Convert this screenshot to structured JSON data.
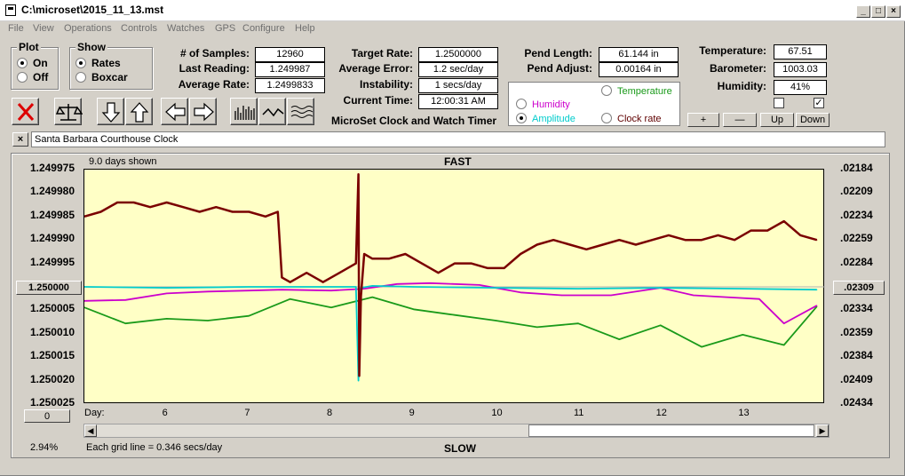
{
  "window": {
    "title": "C:\\microset\\2015_11_13.mst",
    "minimize": "_",
    "maximize": "□",
    "close": "×"
  },
  "menu": [
    "File",
    "View",
    "Operations",
    "Controls",
    "Watches",
    "GPS",
    "Configure",
    "Help"
  ],
  "plot_group": {
    "title": "Plot",
    "on": "On",
    "off": "Off",
    "selected": "On"
  },
  "show_group": {
    "title": "Show",
    "rates": "Rates",
    "boxcar": "Boxcar",
    "selected": "Rates"
  },
  "stats": {
    "samples_label": "# of Samples:",
    "samples": "12960",
    "last_label": "Last Reading:",
    "last": "1.249987",
    "avg_label": "Average Rate:",
    "avg": "1.2499833",
    "target_label": "Target Rate:",
    "target": "1.2500000",
    "avgerr_label": "Average Error:",
    "avgerr": "1.2 sec/day",
    "instab_label": "Instability:",
    "instab": "1 secs/day",
    "time_label": "Current Time:",
    "time": "12:00:31 AM",
    "pendlen_label": "Pend Length:",
    "pendlen": "61.144 in",
    "pendadj_label": "Pend Adjust:",
    "pendadj": "0.00164 in",
    "temp_label": "Temperature:",
    "temp": "67.51",
    "baro_label": "Barometer:",
    "baro": "1003.03",
    "hum_label": "Humidity:",
    "hum": "41%"
  },
  "app_name": "MicroSet Clock and Watch Timer",
  "trace_options": {
    "temperature": "Temperature",
    "humidity": "Humidity",
    "amplitude": "Amplitude",
    "clock_rate": "Clock rate",
    "selected": "Amplitude",
    "colors": {
      "temperature": "#1a9a1a",
      "humidity": "#cc00cc",
      "amplitude": "#00cccc",
      "clock_rate": "#000000"
    }
  },
  "checkboxes": {
    "left_checked": false,
    "right_checked": true,
    "check_mark": "✓"
  },
  "scale_buttons": {
    "plus": "+",
    "minus": "—",
    "up": "Up",
    "down": "Down"
  },
  "toolbar_icons": [
    "close-x-icon",
    "balance-scale-icon",
    "arrow-down-icon",
    "arrow-up-icon",
    "arrow-left-icon",
    "arrow-right-icon",
    "bar-graph-icon",
    "wave-icon",
    "multi-wave-icon"
  ],
  "clock_name": "Santa Barbara Courthouse Clock",
  "clock_close": "×",
  "chart": {
    "days_shown": "9.0 days shown",
    "fast": "FAST",
    "slow": "SLOW",
    "day_label": "Day:",
    "center_left": "1.250000",
    "center_right": ".02309",
    "left_ticks": [
      "1.249975",
      "1.249980",
      "1.249985",
      "1.249990",
      "1.249995",
      "1.250005",
      "1.250010",
      "1.250015",
      "1.250020",
      "1.250025"
    ],
    "right_ticks": [
      ".02184",
      ".02209",
      ".02234",
      ".02259",
      ".02284",
      ".02334",
      ".02359",
      ".02384",
      ".02409",
      ".02434"
    ],
    "zero_button": "0",
    "grid_note": "Each grid line = 0.346 secs/day",
    "percent": "2.94%"
  },
  "chart_data": {
    "type": "line",
    "x_unit": "day",
    "x_ticks": [
      6,
      7,
      8,
      9,
      10,
      11,
      12,
      13
    ],
    "xlim": [
      5.0,
      14.0
    ],
    "ylim_left": [
      1.249975,
      1.250025
    ],
    "ylim_right": [
      0.02184,
      0.02434
    ],
    "left_axis_inverted": true,
    "right_axis_inverted": true,
    "series": [
      {
        "key": "clock_rate",
        "color": "#7a0000",
        "x": [
          5.0,
          5.2,
          5.4,
          5.6,
          5.8,
          6.0,
          6.2,
          6.4,
          6.6,
          6.8,
          7.0,
          7.2,
          7.35,
          7.4,
          7.5,
          7.7,
          7.9,
          8.1,
          8.3,
          8.33,
          8.34,
          8.36,
          8.4,
          8.5,
          8.7,
          8.9,
          9.1,
          9.3,
          9.5,
          9.7,
          9.9,
          10.1,
          10.3,
          10.5,
          10.7,
          10.9,
          11.1,
          11.3,
          11.5,
          11.7,
          11.9,
          12.1,
          12.3,
          12.5,
          12.7,
          12.9,
          13.1,
          13.3,
          13.5,
          13.7,
          13.9
        ],
        "y": [
          1.249985,
          1.249984,
          1.249982,
          1.249982,
          1.249983,
          1.249982,
          1.249983,
          1.249984,
          1.249983,
          1.249984,
          1.249984,
          1.249985,
          1.249984,
          1.249998,
          1.249999,
          1.249997,
          1.249999,
          1.249997,
          1.249995,
          1.249976,
          1.250019,
          1.250002,
          1.249993,
          1.249994,
          1.249994,
          1.249993,
          1.249995,
          1.249997,
          1.249995,
          1.249995,
          1.249996,
          1.249996,
          1.249993,
          1.249991,
          1.24999,
          1.249991,
          1.249992,
          1.249991,
          1.24999,
          1.249991,
          1.24999,
          1.249989,
          1.24999,
          1.24999,
          1.249989,
          1.24999,
          1.249988,
          1.249988,
          1.249986,
          1.249989,
          1.24999
        ]
      },
      {
        "key": "amplitude",
        "color": "#00cccc",
        "x": [
          5.0,
          6.0,
          7.0,
          8.0,
          8.3,
          8.33,
          8.36,
          8.5,
          9.0,
          10.0,
          11.0,
          12.0,
          13.0,
          13.9
        ],
        "y": [
          0.02309,
          0.0231,
          0.02309,
          0.02309,
          0.02309,
          0.02409,
          0.0231,
          0.02308,
          0.02309,
          0.0231,
          0.02311,
          0.0231,
          0.02311,
          0.02312
        ]
      },
      {
        "key": "humidity",
        "color": "#cc00cc",
        "x": [
          5.0,
          5.5,
          6.0,
          6.5,
          7.0,
          7.4,
          8.0,
          8.4,
          8.8,
          9.2,
          9.8,
          10.3,
          10.8,
          11.4,
          12.0,
          12.4,
          12.8,
          13.2,
          13.5,
          13.9
        ],
        "y": [
          0.02324,
          0.02323,
          0.02316,
          0.02314,
          0.02313,
          0.02312,
          0.02313,
          0.02311,
          0.02306,
          0.02305,
          0.02307,
          0.02315,
          0.02318,
          0.02318,
          0.0231,
          0.02318,
          0.0232,
          0.02322,
          0.02348,
          0.02329
        ]
      },
      {
        "key": "temperature",
        "color": "#1a9a1a",
        "x": [
          5.0,
          5.5,
          6.0,
          6.5,
          7.0,
          7.5,
          8.0,
          8.5,
          9.0,
          9.5,
          10.0,
          10.5,
          11.0,
          11.5,
          12.0,
          12.5,
          13.0,
          13.5,
          13.9
        ],
        "y": [
          0.02331,
          0.02348,
          0.02343,
          0.02345,
          0.0234,
          0.02322,
          0.02331,
          0.0232,
          0.02333,
          0.02339,
          0.02345,
          0.02352,
          0.02348,
          0.02365,
          0.0235,
          0.02373,
          0.0236,
          0.02371,
          0.0233
        ]
      }
    ]
  }
}
